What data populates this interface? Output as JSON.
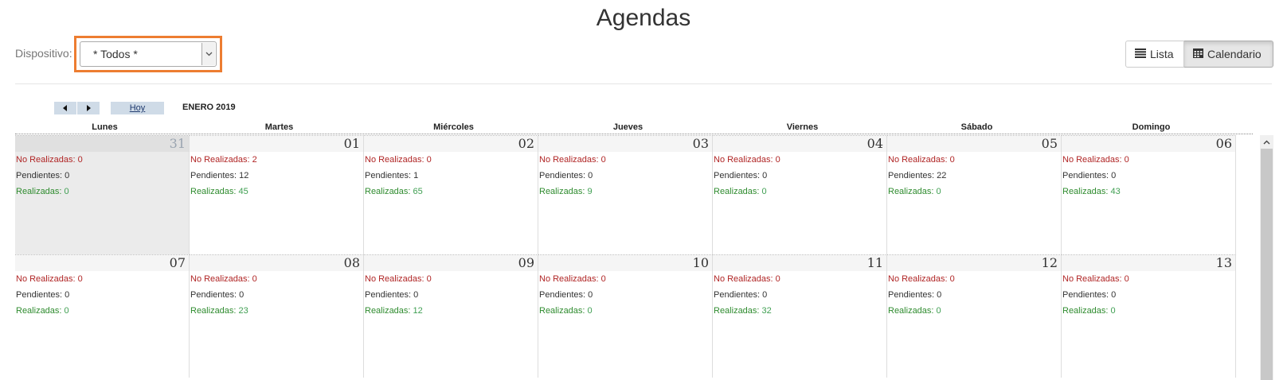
{
  "page": {
    "title": "Agendas"
  },
  "filter": {
    "label": "Dispositivo:",
    "selected": "* Todos *",
    "highlight_color": "#ed7d31",
    "arrow_icon": "chevron-down-icon"
  },
  "view_toggle": {
    "list_label": "Lista",
    "list_icon": "list-icon",
    "calendar_label": "Calendario",
    "calendar_icon": "calendar-icon",
    "active": "Calendario"
  },
  "calendar": {
    "nav": {
      "prev_icon": "triangle-left-icon",
      "next_icon": "triangle-right-icon",
      "today_label": "Hoy"
    },
    "month_label": "ENERO 2019",
    "weekdays": [
      "Lunes",
      "Martes",
      "Miércoles",
      "Jueves",
      "Viernes",
      "Sábado",
      "Domingo"
    ],
    "stat_labels": {
      "no_realizadas": "No Realizadas:",
      "pendientes": "Pendientes:",
      "realizadas": "Realizadas:"
    },
    "colors": {
      "no_realizadas": "#b02525",
      "pendientes": "#333333",
      "realizadas": "#2e8b2e"
    },
    "weeks": [
      [
        {
          "day": "31",
          "other_month": true,
          "no_realizadas": "0",
          "pendientes": "0",
          "realizadas": "0"
        },
        {
          "day": "01",
          "other_month": false,
          "no_realizadas": "2",
          "pendientes": "12",
          "realizadas": "45"
        },
        {
          "day": "02",
          "other_month": false,
          "no_realizadas": "0",
          "pendientes": "1",
          "realizadas": "65"
        },
        {
          "day": "03",
          "other_month": false,
          "no_realizadas": "0",
          "pendientes": "0",
          "realizadas": "9"
        },
        {
          "day": "04",
          "other_month": false,
          "no_realizadas": "0",
          "pendientes": "0",
          "realizadas": "0"
        },
        {
          "day": "05",
          "other_month": false,
          "no_realizadas": "0",
          "pendientes": "22",
          "realizadas": "0"
        },
        {
          "day": "06",
          "other_month": false,
          "no_realizadas": "0",
          "pendientes": "0",
          "realizadas": "43"
        }
      ],
      [
        {
          "day": "07",
          "other_month": false,
          "no_realizadas": "0",
          "pendientes": "0",
          "realizadas": "0"
        },
        {
          "day": "08",
          "other_month": false,
          "no_realizadas": "0",
          "pendientes": "0",
          "realizadas": "23"
        },
        {
          "day": "09",
          "other_month": false,
          "no_realizadas": "0",
          "pendientes": "0",
          "realizadas": "12"
        },
        {
          "day": "10",
          "other_month": false,
          "no_realizadas": "0",
          "pendientes": "0",
          "realizadas": "0"
        },
        {
          "day": "11",
          "other_month": false,
          "no_realizadas": "0",
          "pendientes": "0",
          "realizadas": "32"
        },
        {
          "day": "12",
          "other_month": false,
          "no_realizadas": "0",
          "pendientes": "0",
          "realizadas": "0"
        },
        {
          "day": "13",
          "other_month": false,
          "no_realizadas": "0",
          "pendientes": "0",
          "realizadas": "0"
        }
      ]
    ]
  }
}
